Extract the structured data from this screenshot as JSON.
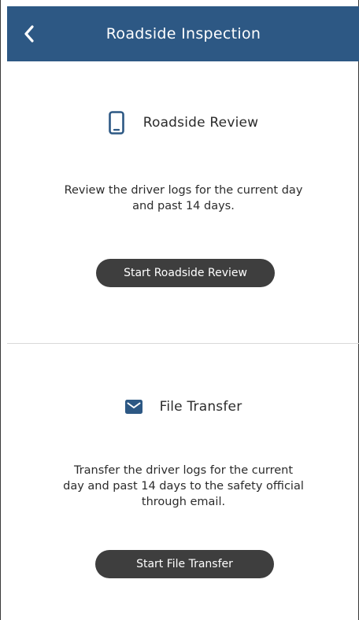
{
  "header": {
    "title": "Roadside Inspection",
    "back_icon": "chevron-left-icon",
    "background_color": "#2d5884"
  },
  "sections": [
    {
      "title": "Roadside Review",
      "icon": "tablet-icon",
      "description_lines": [
        "Review the driver logs for the current day",
        "and past 14 days."
      ],
      "button_label": "Start Roadside Review"
    },
    {
      "title": "File Transfer",
      "icon": "envelope-icon",
      "description_lines": [
        "Transfer the driver logs for the current",
        "day and past 14 days to the safety official",
        "through email."
      ],
      "button_label": "Start File Transfer"
    }
  ],
  "colors": {
    "accent": "#2d5884",
    "button": "#3e3e3e",
    "text": "#2b2b2b",
    "divider": "#d9d9d9"
  }
}
